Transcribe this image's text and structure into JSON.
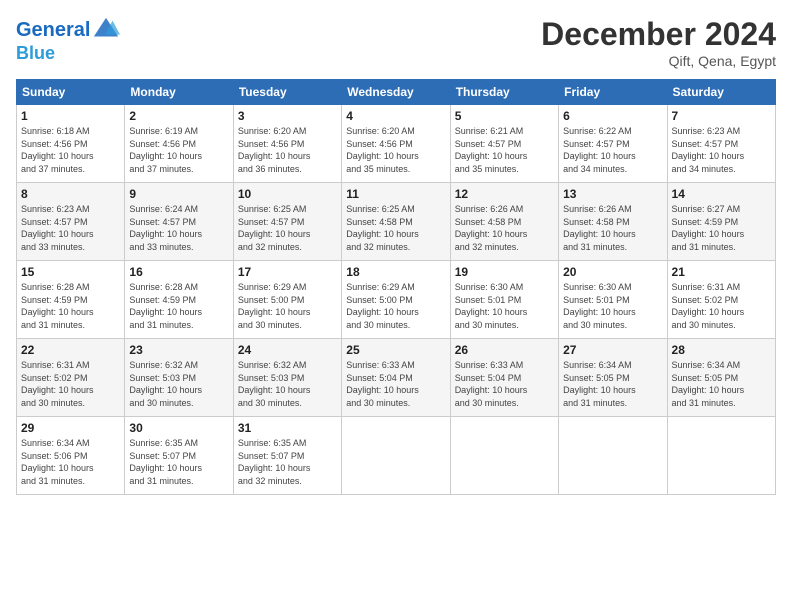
{
  "header": {
    "logo_line1": "General",
    "logo_line2": "Blue",
    "month_title": "December 2024",
    "location": "Qift, Qena, Egypt"
  },
  "days_of_week": [
    "Sunday",
    "Monday",
    "Tuesday",
    "Wednesday",
    "Thursday",
    "Friday",
    "Saturday"
  ],
  "weeks": [
    [
      {
        "day": "1",
        "info": "Sunrise: 6:18 AM\nSunset: 4:56 PM\nDaylight: 10 hours\nand 37 minutes."
      },
      {
        "day": "2",
        "info": "Sunrise: 6:19 AM\nSunset: 4:56 PM\nDaylight: 10 hours\nand 37 minutes."
      },
      {
        "day": "3",
        "info": "Sunrise: 6:20 AM\nSunset: 4:56 PM\nDaylight: 10 hours\nand 36 minutes."
      },
      {
        "day": "4",
        "info": "Sunrise: 6:20 AM\nSunset: 4:56 PM\nDaylight: 10 hours\nand 35 minutes."
      },
      {
        "day": "5",
        "info": "Sunrise: 6:21 AM\nSunset: 4:57 PM\nDaylight: 10 hours\nand 35 minutes."
      },
      {
        "day": "6",
        "info": "Sunrise: 6:22 AM\nSunset: 4:57 PM\nDaylight: 10 hours\nand 34 minutes."
      },
      {
        "day": "7",
        "info": "Sunrise: 6:23 AM\nSunset: 4:57 PM\nDaylight: 10 hours\nand 34 minutes."
      }
    ],
    [
      {
        "day": "8",
        "info": "Sunrise: 6:23 AM\nSunset: 4:57 PM\nDaylight: 10 hours\nand 33 minutes."
      },
      {
        "day": "9",
        "info": "Sunrise: 6:24 AM\nSunset: 4:57 PM\nDaylight: 10 hours\nand 33 minutes."
      },
      {
        "day": "10",
        "info": "Sunrise: 6:25 AM\nSunset: 4:57 PM\nDaylight: 10 hours\nand 32 minutes."
      },
      {
        "day": "11",
        "info": "Sunrise: 6:25 AM\nSunset: 4:58 PM\nDaylight: 10 hours\nand 32 minutes."
      },
      {
        "day": "12",
        "info": "Sunrise: 6:26 AM\nSunset: 4:58 PM\nDaylight: 10 hours\nand 32 minutes."
      },
      {
        "day": "13",
        "info": "Sunrise: 6:26 AM\nSunset: 4:58 PM\nDaylight: 10 hours\nand 31 minutes."
      },
      {
        "day": "14",
        "info": "Sunrise: 6:27 AM\nSunset: 4:59 PM\nDaylight: 10 hours\nand 31 minutes."
      }
    ],
    [
      {
        "day": "15",
        "info": "Sunrise: 6:28 AM\nSunset: 4:59 PM\nDaylight: 10 hours\nand 31 minutes."
      },
      {
        "day": "16",
        "info": "Sunrise: 6:28 AM\nSunset: 4:59 PM\nDaylight: 10 hours\nand 31 minutes."
      },
      {
        "day": "17",
        "info": "Sunrise: 6:29 AM\nSunset: 5:00 PM\nDaylight: 10 hours\nand 30 minutes."
      },
      {
        "day": "18",
        "info": "Sunrise: 6:29 AM\nSunset: 5:00 PM\nDaylight: 10 hours\nand 30 minutes."
      },
      {
        "day": "19",
        "info": "Sunrise: 6:30 AM\nSunset: 5:01 PM\nDaylight: 10 hours\nand 30 minutes."
      },
      {
        "day": "20",
        "info": "Sunrise: 6:30 AM\nSunset: 5:01 PM\nDaylight: 10 hours\nand 30 minutes."
      },
      {
        "day": "21",
        "info": "Sunrise: 6:31 AM\nSunset: 5:02 PM\nDaylight: 10 hours\nand 30 minutes."
      }
    ],
    [
      {
        "day": "22",
        "info": "Sunrise: 6:31 AM\nSunset: 5:02 PM\nDaylight: 10 hours\nand 30 minutes."
      },
      {
        "day": "23",
        "info": "Sunrise: 6:32 AM\nSunset: 5:03 PM\nDaylight: 10 hours\nand 30 minutes."
      },
      {
        "day": "24",
        "info": "Sunrise: 6:32 AM\nSunset: 5:03 PM\nDaylight: 10 hours\nand 30 minutes."
      },
      {
        "day": "25",
        "info": "Sunrise: 6:33 AM\nSunset: 5:04 PM\nDaylight: 10 hours\nand 30 minutes."
      },
      {
        "day": "26",
        "info": "Sunrise: 6:33 AM\nSunset: 5:04 PM\nDaylight: 10 hours\nand 30 minutes."
      },
      {
        "day": "27",
        "info": "Sunrise: 6:34 AM\nSunset: 5:05 PM\nDaylight: 10 hours\nand 31 minutes."
      },
      {
        "day": "28",
        "info": "Sunrise: 6:34 AM\nSunset: 5:05 PM\nDaylight: 10 hours\nand 31 minutes."
      }
    ],
    [
      {
        "day": "29",
        "info": "Sunrise: 6:34 AM\nSunset: 5:06 PM\nDaylight: 10 hours\nand 31 minutes."
      },
      {
        "day": "30",
        "info": "Sunrise: 6:35 AM\nSunset: 5:07 PM\nDaylight: 10 hours\nand 31 minutes."
      },
      {
        "day": "31",
        "info": "Sunrise: 6:35 AM\nSunset: 5:07 PM\nDaylight: 10 hours\nand 32 minutes."
      },
      {
        "day": "",
        "info": ""
      },
      {
        "day": "",
        "info": ""
      },
      {
        "day": "",
        "info": ""
      },
      {
        "day": "",
        "info": ""
      }
    ]
  ]
}
